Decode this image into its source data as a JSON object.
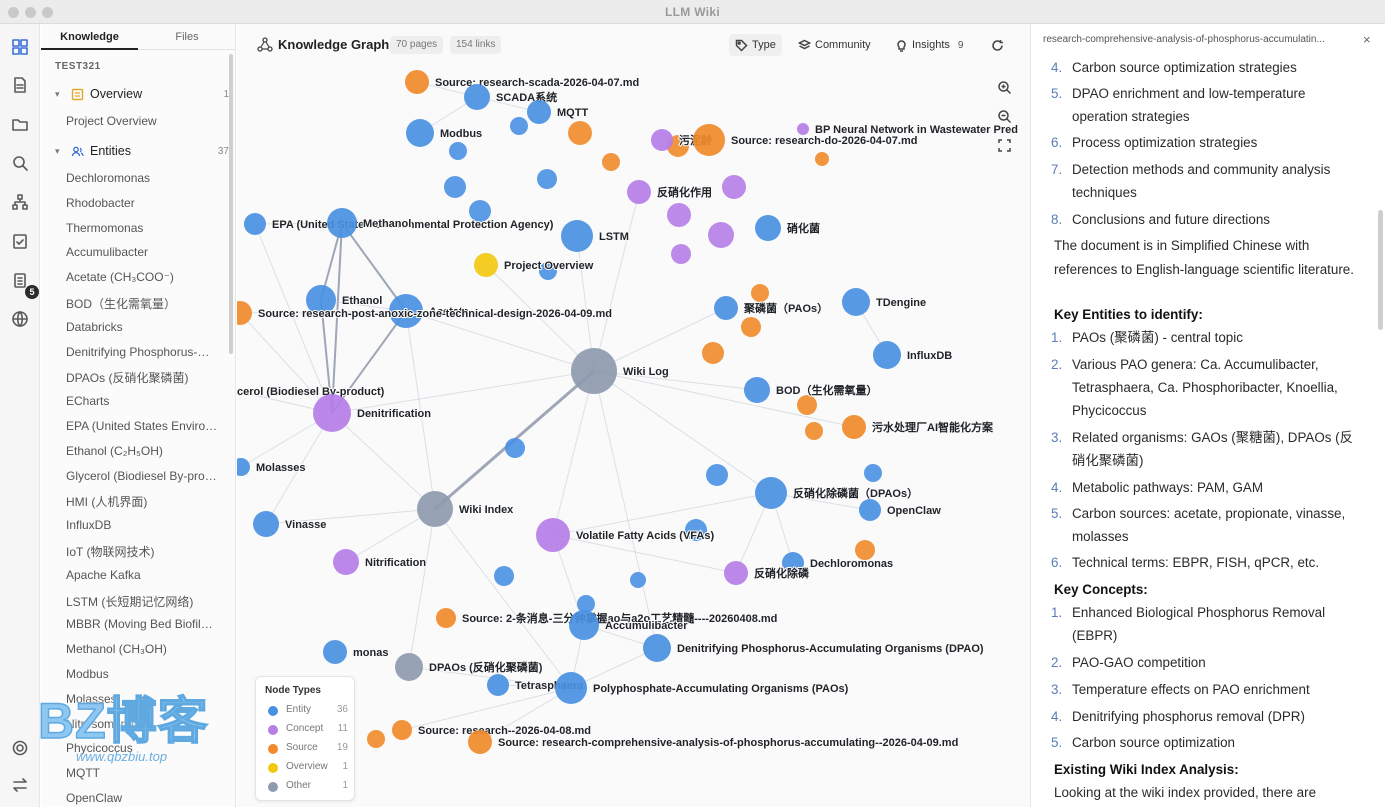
{
  "app": {
    "title": "LLM Wiki"
  },
  "rail": {
    "icons": [
      "graph-view-icon",
      "document-icon",
      "folder-icon",
      "search-icon",
      "sitemap-icon",
      "checklist-icon",
      "clipboard-icon",
      "globe-icon"
    ],
    "badge": "5",
    "accent": "#3b6fd8"
  },
  "sidebar": {
    "tabs": [
      "Knowledge",
      "Files"
    ],
    "project": "TEST321",
    "overview": {
      "label": "Overview",
      "count": "1",
      "items": [
        "Project Overview"
      ]
    },
    "entities": {
      "label": "Entities",
      "count": "37",
      "items": [
        "Dechloromonas",
        "Rhodobacter",
        "Thermomonas",
        "Accumulibacter",
        "Acetate (CH₃COO⁻)",
        "BOD（生化需氧量）",
        "Databricks",
        "Denitrifying Phosphorus-…",
        "DPAOs (反硝化聚磷菌)",
        "ECharts",
        "EPA (United States Enviro…",
        "Ethanol (C₂H₅OH)",
        "Glycerol (Biodiesel By-pro…",
        "HMI (人机界面)",
        "InfluxDB",
        "IoT (物联网技术)",
        "Apache Kafka",
        "LSTM (长短期记忆网络)",
        "MBBR (Moving Bed Biofil…",
        "Methanol (CH₃OH)",
        "Modbus",
        "Molasses",
        "Nitrosomonas",
        "Phycicoccus",
        "MQTT",
        "OpenClaw"
      ]
    }
  },
  "graph": {
    "title": "Knowledge Graph",
    "pages": "70 pages",
    "links": "154 links",
    "buttons": {
      "type": "Type",
      "community": "Community",
      "insights": "Insights",
      "insights_count": "9"
    },
    "controls": [
      "zoom-in-icon",
      "zoom-out-icon",
      "fit-view-icon",
      "refresh-icon"
    ],
    "colors": {
      "Entity": "#4a90e2",
      "Concept": "#b57ee8",
      "Source": "#f08a2a",
      "Overview": "#f2c811",
      "Other": "#8e9aae"
    },
    "nodes": [
      {
        "id": "n1",
        "label": "Source: research-scada-2026-04-07.md",
        "type": "Source"
      },
      {
        "id": "n2",
        "label": "SCADA系统",
        "type": "Entity"
      },
      {
        "id": "n3",
        "label": "Modbus",
        "type": "Entity"
      },
      {
        "id": "n4",
        "label": "MQTT",
        "type": "Entity"
      },
      {
        "id": "n5",
        "label": "污泥龄",
        "type": "Concept"
      },
      {
        "id": "n6",
        "label": "Source: research-do-2026-04-07.md",
        "type": "Source"
      },
      {
        "id": "n7",
        "label": "BP Neural Network in Wastewater Pred",
        "type": "Concept"
      },
      {
        "id": "n8",
        "label": "反硝化作用",
        "type": "Concept"
      },
      {
        "id": "n9",
        "label": "EPA (United States Environmental Protection Agency)",
        "type": "Entity"
      },
      {
        "id": "n10",
        "label": "Methanol",
        "type": "Entity"
      },
      {
        "id": "n11",
        "label": "LSTM",
        "type": "Entity"
      },
      {
        "id": "n12",
        "label": "硝化菌",
        "type": "Entity"
      },
      {
        "id": "n13",
        "label": "Project Overview",
        "type": "Overview"
      },
      {
        "id": "n14",
        "label": "Ethanol",
        "type": "Entity"
      },
      {
        "id": "n15",
        "label": "Acetate",
        "type": "Entity"
      },
      {
        "id": "n16",
        "label": "Source: research-post-anoxic-zone-technical-design-2026-04-09.md",
        "type": "Source"
      },
      {
        "id": "n17",
        "label": "聚磷菌（PAOs）",
        "type": "Entity"
      },
      {
        "id": "n18",
        "label": "TDengine",
        "type": "Entity"
      },
      {
        "id": "n19",
        "label": "InfluxDB",
        "type": "Entity"
      },
      {
        "id": "n20",
        "label": "Wiki Log",
        "type": "Other"
      },
      {
        "id": "n21",
        "label": "BOD（生化需氧量）",
        "type": "Entity"
      },
      {
        "id": "n22",
        "label": "cerol (Biodiesel By-product)",
        "type": "Entity"
      },
      {
        "id": "n23",
        "label": "Denitrification",
        "type": "Concept"
      },
      {
        "id": "n24",
        "label": "污水处理厂AI智能化方案",
        "type": "Source"
      },
      {
        "id": "n25",
        "label": "Molasses",
        "type": "Entity"
      },
      {
        "id": "n26",
        "label": "Wiki Index",
        "type": "Other"
      },
      {
        "id": "n27",
        "label": "反硝化除磷菌（DPAOs）",
        "type": "Entity"
      },
      {
        "id": "n28",
        "label": "OpenClaw",
        "type": "Entity"
      },
      {
        "id": "n29",
        "label": "Vinasse",
        "type": "Entity"
      },
      {
        "id": "n30",
        "label": "Volatile Fatty Acids (VFAs)",
        "type": "Concept"
      },
      {
        "id": "n31",
        "label": "Nitrification",
        "type": "Concept"
      },
      {
        "id": "n32",
        "label": "Dechloromonas",
        "type": "Entity"
      },
      {
        "id": "n33",
        "label": "反硝化除磷",
        "type": "Concept"
      },
      {
        "id": "n34",
        "label": "Source: 2-条消息-三分钟掌握ao与a2o工艺精髓----20260408.md",
        "type": "Source"
      },
      {
        "id": "n35",
        "label": "Accumulibacter",
        "type": "Entity"
      },
      {
        "id": "n36",
        "label": "Denitrifying Phosphorus-Accumulating Organisms (DPAO)",
        "type": "Entity"
      },
      {
        "id": "n37",
        "label": "DPAOs (反硝化聚磷菌)",
        "type": "Other"
      },
      {
        "id": "n38",
        "label": "monas",
        "type": "Entity"
      },
      {
        "id": "n39",
        "label": "Tetrasphaera",
        "type": "Entity"
      },
      {
        "id": "n40",
        "label": "Polyphosphate-Accumulating Organisms (PAOs)",
        "type": "Entity"
      },
      {
        "id": "n41",
        "label": "Source: research--2026-04-08.md",
        "type": "Source"
      },
      {
        "id": "n42",
        "label": "Source: research-comprehensive-analysis-of-phosphorus-accumulating--2026-04-09.md",
        "type": "Source"
      }
    ],
    "legend": {
      "title": "Node Types",
      "items": [
        {
          "label": "Entity",
          "count": "36",
          "color": "#4a90e2"
        },
        {
          "label": "Concept",
          "count": "11",
          "color": "#b57ee8"
        },
        {
          "label": "Source",
          "count": "19",
          "color": "#f08a2a"
        },
        {
          "label": "Overview",
          "count": "1",
          "color": "#f2c811"
        },
        {
          "label": "Other",
          "count": "1",
          "color": "#8e9aae"
        }
      ]
    }
  },
  "watermark": {
    "big": "BZ博客",
    "url": "www.qbzbiu.top"
  },
  "panel": {
    "path": "research-comprehensive-analysis-of-phosphorus-accumulatin...",
    "list1": [
      {
        "n": "4.",
        "t": "Carbon source optimization strategies"
      },
      {
        "n": "5.",
        "t": "DPAO enrichment and low-temperature operation strategies"
      },
      {
        "n": "6.",
        "t": "Process optimization strategies"
      },
      {
        "n": "7.",
        "t": "Detection methods and community analysis techniques"
      },
      {
        "n": "8.",
        "t": "Conclusions and future directions"
      }
    ],
    "para1": "The document is in Simplified Chinese with references to English-language scientific literature.",
    "head1": "Key Entities to identify:",
    "list2": [
      {
        "n": "1.",
        "t": "PAOs (聚磷菌) - central topic"
      },
      {
        "n": "2.",
        "t": "Various PAO genera: Ca. Accumulibacter, Tetrasphaera, Ca. Phosphoribacter, Knoellia, Phycicoccus"
      },
      {
        "n": "3.",
        "t": "Related organisms: GAOs (聚糖菌), DPAOs (反硝化聚磷菌)"
      },
      {
        "n": "4.",
        "t": "Metabolic pathways: PAM, GAM"
      },
      {
        "n": "5.",
        "t": "Carbon sources: acetate, propionate, vinasse, molasses"
      },
      {
        "n": "6.",
        "t": "Technical terms: EBPR, FISH, qPCR, etc."
      }
    ],
    "head2": "Key Concepts:",
    "list3": [
      {
        "n": "1.",
        "t": "Enhanced Biological Phosphorus Removal (EBPR)"
      },
      {
        "n": "2.",
        "t": "PAO-GAO competition"
      },
      {
        "n": "3.",
        "t": "Temperature effects on PAO enrichment"
      },
      {
        "n": "4.",
        "t": "Denitrifying phosphorus removal (DPR)"
      },
      {
        "n": "5.",
        "t": "Carbon source optimization"
      }
    ],
    "head3": "Existing Wiki Index Analysis:",
    "para2": "Looking at the wiki index provided, there are several"
  }
}
